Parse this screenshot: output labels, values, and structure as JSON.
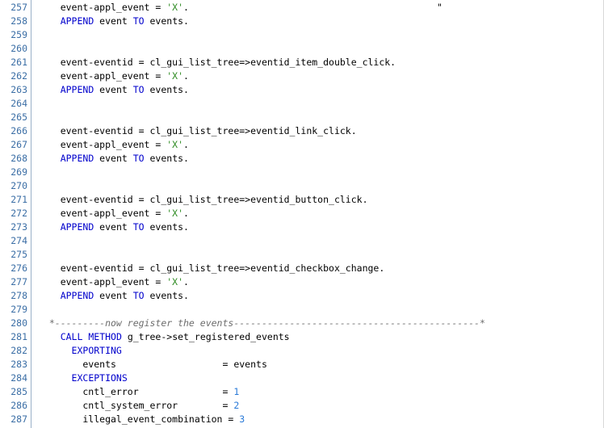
{
  "editor": {
    "lines": [
      {
        "no": "257",
        "parts": [
          {
            "t": "    event-appl_event = ",
            "c": ""
          },
          {
            "t": "'X'",
            "c": "str"
          },
          {
            "t": ".",
            "c": ""
          }
        ],
        "trail": "\""
      },
      {
        "no": "258",
        "parts": [
          {
            "t": "    ",
            "c": ""
          },
          {
            "t": "APPEND",
            "c": "kw"
          },
          {
            "t": " event ",
            "c": ""
          },
          {
            "t": "TO",
            "c": "kw"
          },
          {
            "t": " events.",
            "c": ""
          }
        ]
      },
      {
        "no": "259",
        "parts": []
      },
      {
        "no": "260",
        "parts": []
      },
      {
        "no": "261",
        "parts": [
          {
            "t": "    event-eventid = cl_gui_list_tree=>eventid_item_double_click.",
            "c": ""
          }
        ]
      },
      {
        "no": "262",
        "parts": [
          {
            "t": "    event-appl_event = ",
            "c": ""
          },
          {
            "t": "'X'",
            "c": "str"
          },
          {
            "t": ".",
            "c": ""
          }
        ]
      },
      {
        "no": "263",
        "parts": [
          {
            "t": "    ",
            "c": ""
          },
          {
            "t": "APPEND",
            "c": "kw"
          },
          {
            "t": " event ",
            "c": ""
          },
          {
            "t": "TO",
            "c": "kw"
          },
          {
            "t": " events.",
            "c": ""
          }
        ]
      },
      {
        "no": "264",
        "parts": []
      },
      {
        "no": "265",
        "parts": []
      },
      {
        "no": "266",
        "parts": [
          {
            "t": "    event-eventid = cl_gui_list_tree=>eventid_link_click.",
            "c": ""
          }
        ]
      },
      {
        "no": "267",
        "parts": [
          {
            "t": "    event-appl_event = ",
            "c": ""
          },
          {
            "t": "'X'",
            "c": "str"
          },
          {
            "t": ".",
            "c": ""
          }
        ]
      },
      {
        "no": "268",
        "parts": [
          {
            "t": "    ",
            "c": ""
          },
          {
            "t": "APPEND",
            "c": "kw"
          },
          {
            "t": " event ",
            "c": ""
          },
          {
            "t": "TO",
            "c": "kw"
          },
          {
            "t": " events.",
            "c": ""
          }
        ]
      },
      {
        "no": "269",
        "parts": []
      },
      {
        "no": "270",
        "parts": []
      },
      {
        "no": "271",
        "parts": [
          {
            "t": "    event-eventid = cl_gui_list_tree=>eventid_button_click.",
            "c": ""
          }
        ]
      },
      {
        "no": "272",
        "parts": [
          {
            "t": "    event-appl_event = ",
            "c": ""
          },
          {
            "t": "'X'",
            "c": "str"
          },
          {
            "t": ".",
            "c": ""
          }
        ]
      },
      {
        "no": "273",
        "parts": [
          {
            "t": "    ",
            "c": ""
          },
          {
            "t": "APPEND",
            "c": "kw"
          },
          {
            "t": " event ",
            "c": ""
          },
          {
            "t": "TO",
            "c": "kw"
          },
          {
            "t": " events.",
            "c": ""
          }
        ]
      },
      {
        "no": "274",
        "parts": []
      },
      {
        "no": "275",
        "parts": []
      },
      {
        "no": "276",
        "parts": [
          {
            "t": "    event-eventid = cl_gui_list_tree=>eventid_checkbox_change.",
            "c": ""
          }
        ]
      },
      {
        "no": "277",
        "parts": [
          {
            "t": "    event-appl_event = ",
            "c": ""
          },
          {
            "t": "'X'",
            "c": "str"
          },
          {
            "t": ".",
            "c": ""
          }
        ]
      },
      {
        "no": "278",
        "parts": [
          {
            "t": "    ",
            "c": ""
          },
          {
            "t": "APPEND",
            "c": "kw"
          },
          {
            "t": " event ",
            "c": ""
          },
          {
            "t": "TO",
            "c": "kw"
          },
          {
            "t": " events.",
            "c": ""
          }
        ]
      },
      {
        "no": "279",
        "parts": []
      },
      {
        "no": "280",
        "parts": [
          {
            "t": "  *---------now register the events--------------------------------------------*",
            "c": "cmt"
          }
        ]
      },
      {
        "no": "281",
        "parts": [
          {
            "t": "    ",
            "c": ""
          },
          {
            "t": "CALL",
            "c": "kw"
          },
          {
            "t": " ",
            "c": ""
          },
          {
            "t": "METHOD",
            "c": "kw"
          },
          {
            "t": " g_tree->set_registered_events",
            "c": ""
          }
        ]
      },
      {
        "no": "282",
        "parts": [
          {
            "t": "      ",
            "c": ""
          },
          {
            "t": "EXPORTING",
            "c": "kw"
          }
        ]
      },
      {
        "no": "283",
        "parts": [
          {
            "t": "        events                   = events",
            "c": ""
          }
        ]
      },
      {
        "no": "284",
        "parts": [
          {
            "t": "      ",
            "c": ""
          },
          {
            "t": "EXCEPTIONS",
            "c": "kw"
          }
        ]
      },
      {
        "no": "285",
        "parts": [
          {
            "t": "        cntl_error               = ",
            "c": ""
          },
          {
            "t": "1",
            "c": "num"
          }
        ]
      },
      {
        "no": "286",
        "parts": [
          {
            "t": "        cntl_system_error        = ",
            "c": ""
          },
          {
            "t": "2",
            "c": "num"
          }
        ]
      },
      {
        "no": "287",
        "parts": [
          {
            "t": "        illegal_event_combination = ",
            "c": ""
          },
          {
            "t": "3",
            "c": "num"
          }
        ]
      }
    ]
  },
  "colors": {
    "keyword": "#0000cc",
    "string": "#2e8b22",
    "number": "#2a7ad8",
    "comment": "#6d6d6d",
    "line_number": "#3b6ea5"
  }
}
